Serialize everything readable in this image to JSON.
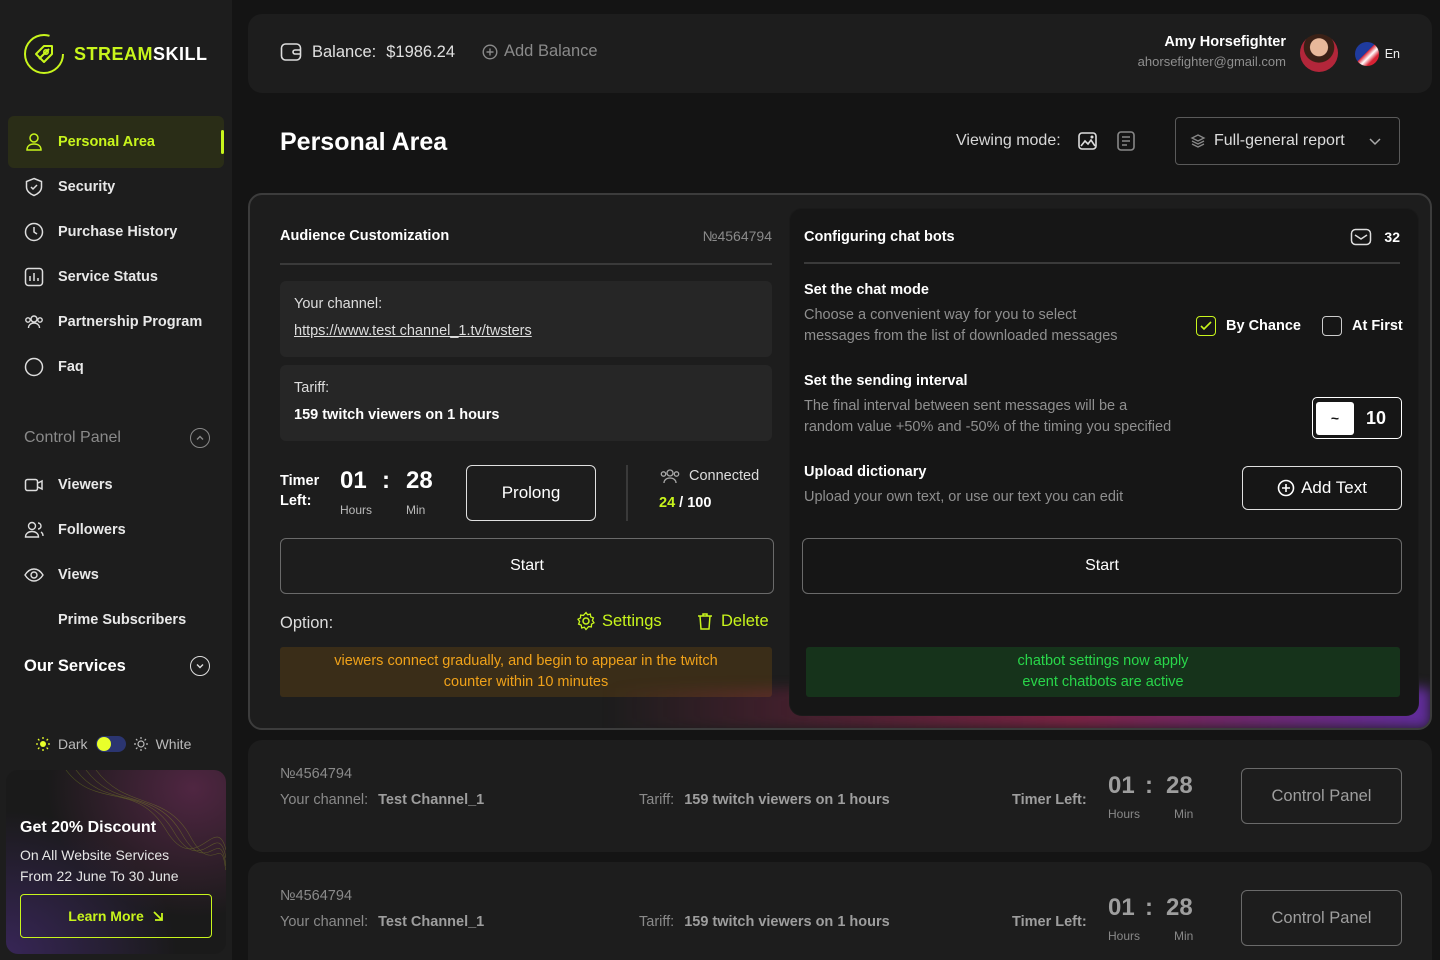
{
  "brand": {
    "name_accent": "STREAM",
    "name_rest": "SKILL"
  },
  "sidebar": {
    "items": [
      {
        "label": "Personal Area",
        "icon": "user-icon"
      },
      {
        "label": "Security",
        "icon": "shield-icon"
      },
      {
        "label": "Purchase History",
        "icon": "clock-icon"
      },
      {
        "label": "Service Status",
        "icon": "bar-chart-icon"
      },
      {
        "label": "Partnership Program",
        "icon": "group-icon"
      },
      {
        "label": "Faq",
        "icon": "circle-icon"
      }
    ],
    "control_panel": {
      "title": "Control Panel",
      "items": [
        {
          "label": "Viewers",
          "icon": "video-icon"
        },
        {
          "label": "Followers",
          "icon": "users-icon"
        },
        {
          "label": "Views",
          "icon": "eye-icon"
        },
        {
          "label": "Prime Subscribers",
          "icon": ""
        }
      ]
    },
    "our_services": "Our Services",
    "theme": {
      "dark": "Dark",
      "white": "White"
    },
    "promo": {
      "title": "Get 20% Discount",
      "line1": "On All Website Services",
      "line2": "From 22 June To 30 June",
      "button": "Learn More"
    }
  },
  "topbar": {
    "balance_label": "Balance:",
    "balance_value": "$1986.24",
    "add_balance": "Add Balance",
    "user_name": "Amy Horsefighter",
    "user_email": "ahorsefighter@gmail.com",
    "lang": "En"
  },
  "page": {
    "title": "Personal Area",
    "viewing_mode": "Viewing mode:",
    "report_select": "Full-general report"
  },
  "audience": {
    "title": "Audience Customization",
    "number": "№4564794",
    "channel_label": "Your channel:",
    "channel_url": "https://www.test channel_1.tv/twsters",
    "tariff_label": "Tariff:",
    "tariff_value": "159 twitch viewers on 1 hours",
    "timer_label_1": "Timer",
    "timer_label_2": "Left:",
    "hours": "01",
    "minutes": "28",
    "hours_label": "Hours",
    "minutes_label": "Min",
    "prolong": "Prolong",
    "connected_label": "Connected",
    "connected_current": "24",
    "connected_total": "100",
    "start": "Start",
    "option_label": "Option:",
    "settings": "Settings",
    "delete": "Delete",
    "notice_1": "viewers connect gradually, and begin to appear in the twitch",
    "notice_2": "counter within 10 minutes"
  },
  "chatbots": {
    "title": "Configuring chat bots",
    "count": "32",
    "mode_title": "Set the chat mode",
    "mode_desc_1": "Choose a convenient way for you to select",
    "mode_desc_2": "messages from the list of downloaded messages",
    "by_chance": "By Chance",
    "at_first": "At First",
    "interval_title": "Set the sending interval",
    "interval_desc_1": "The final interval between sent messages will be a",
    "interval_desc_2": "random value +50% and -50% of the timing you specified",
    "interval_tilde": "~",
    "interval_value": "10",
    "upload_title": "Upload dictionary",
    "upload_desc": "Upload your own text, or use our text you can edit",
    "add_text": "Add Text",
    "start": "Start",
    "notice_1": "chatbot settings now apply",
    "notice_2": "event chatbots are active"
  },
  "orders": [
    {
      "number": "№4564794",
      "channel_label": "Your channel:",
      "channel": "Test Channel_1",
      "tariff_label": "Tariff:",
      "tariff": "159 twitch viewers on 1 hours",
      "timer_label": "Timer Left:",
      "hours": "01",
      "minutes": "28",
      "hours_label": "Hours",
      "minutes_label": "Min",
      "button": "Control Panel"
    },
    {
      "number": "№4564794",
      "channel_label": "Your channel:",
      "channel": "Test Channel_1",
      "tariff_label": "Tariff:",
      "tariff": "159 twitch viewers on 1 hours",
      "timer_label": "Timer Left:",
      "hours": "01",
      "minutes": "28",
      "hours_label": "Hours",
      "minutes_label": "Min",
      "button": "Control Panel"
    }
  ],
  "colors": {
    "accent": "#c8f51c",
    "warning": "#f0a21a",
    "success": "#29d64a",
    "background": "#141414",
    "panel": "#1d1d1d"
  }
}
